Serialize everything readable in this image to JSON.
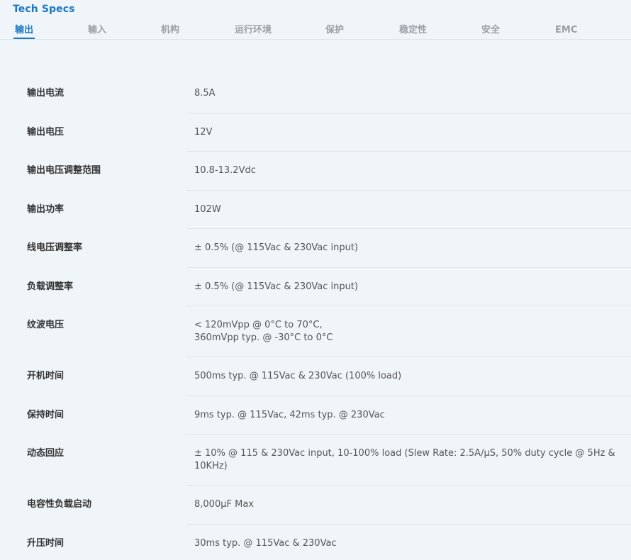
{
  "header": {
    "title": "Tech Specs"
  },
  "tabs": [
    {
      "label": "输出",
      "active": true
    },
    {
      "label": "输入",
      "active": false
    },
    {
      "label": "机构",
      "active": false
    },
    {
      "label": "运行环境",
      "active": false
    },
    {
      "label": "保护",
      "active": false
    },
    {
      "label": "稳定性",
      "active": false
    },
    {
      "label": "安全",
      "active": false
    },
    {
      "label": "EMC",
      "active": false
    }
  ],
  "specs": [
    {
      "label": "输出电流",
      "value": "8.5A"
    },
    {
      "label": "输出电压",
      "value": "12V"
    },
    {
      "label": "输出电压调整范围",
      "value": "10.8-13.2Vdc"
    },
    {
      "label": "输出功率",
      "value": "102W"
    },
    {
      "label": "线电压调整率",
      "value": "± 0.5% (@ 115Vac & 230Vac input)"
    },
    {
      "label": "负载调整率",
      "value": "± 0.5% (@ 115Vac & 230Vac input)"
    },
    {
      "label": "纹波电压",
      "value": "< 120mVpp @ 0°C to 70°C,\n360mVpp typ. @ -30°C to 0°C"
    },
    {
      "label": "开机时间",
      "value": "500ms typ. @ 115Vac & 230Vac (100% load)"
    },
    {
      "label": "保持时间",
      "value": "9ms typ. @ 115Vac, 42ms typ. @ 230Vac"
    },
    {
      "label": "动态回应",
      "value": "± 10% @ 115 & 230Vac input, 10-100% load (Slew Rate: 2.5A/µS, 50% duty cycle @ 5Hz & 10KHz)"
    },
    {
      "label": "电容性负载启动",
      "value": "8,000µF Max"
    },
    {
      "label": "升压时间",
      "value": "30ms typ. @ 115Vac & 230Vac"
    }
  ],
  "colors": {
    "accent": "#1c78c4",
    "background": "#f0f5f9",
    "tab_inactive": "#9aa0a6"
  }
}
